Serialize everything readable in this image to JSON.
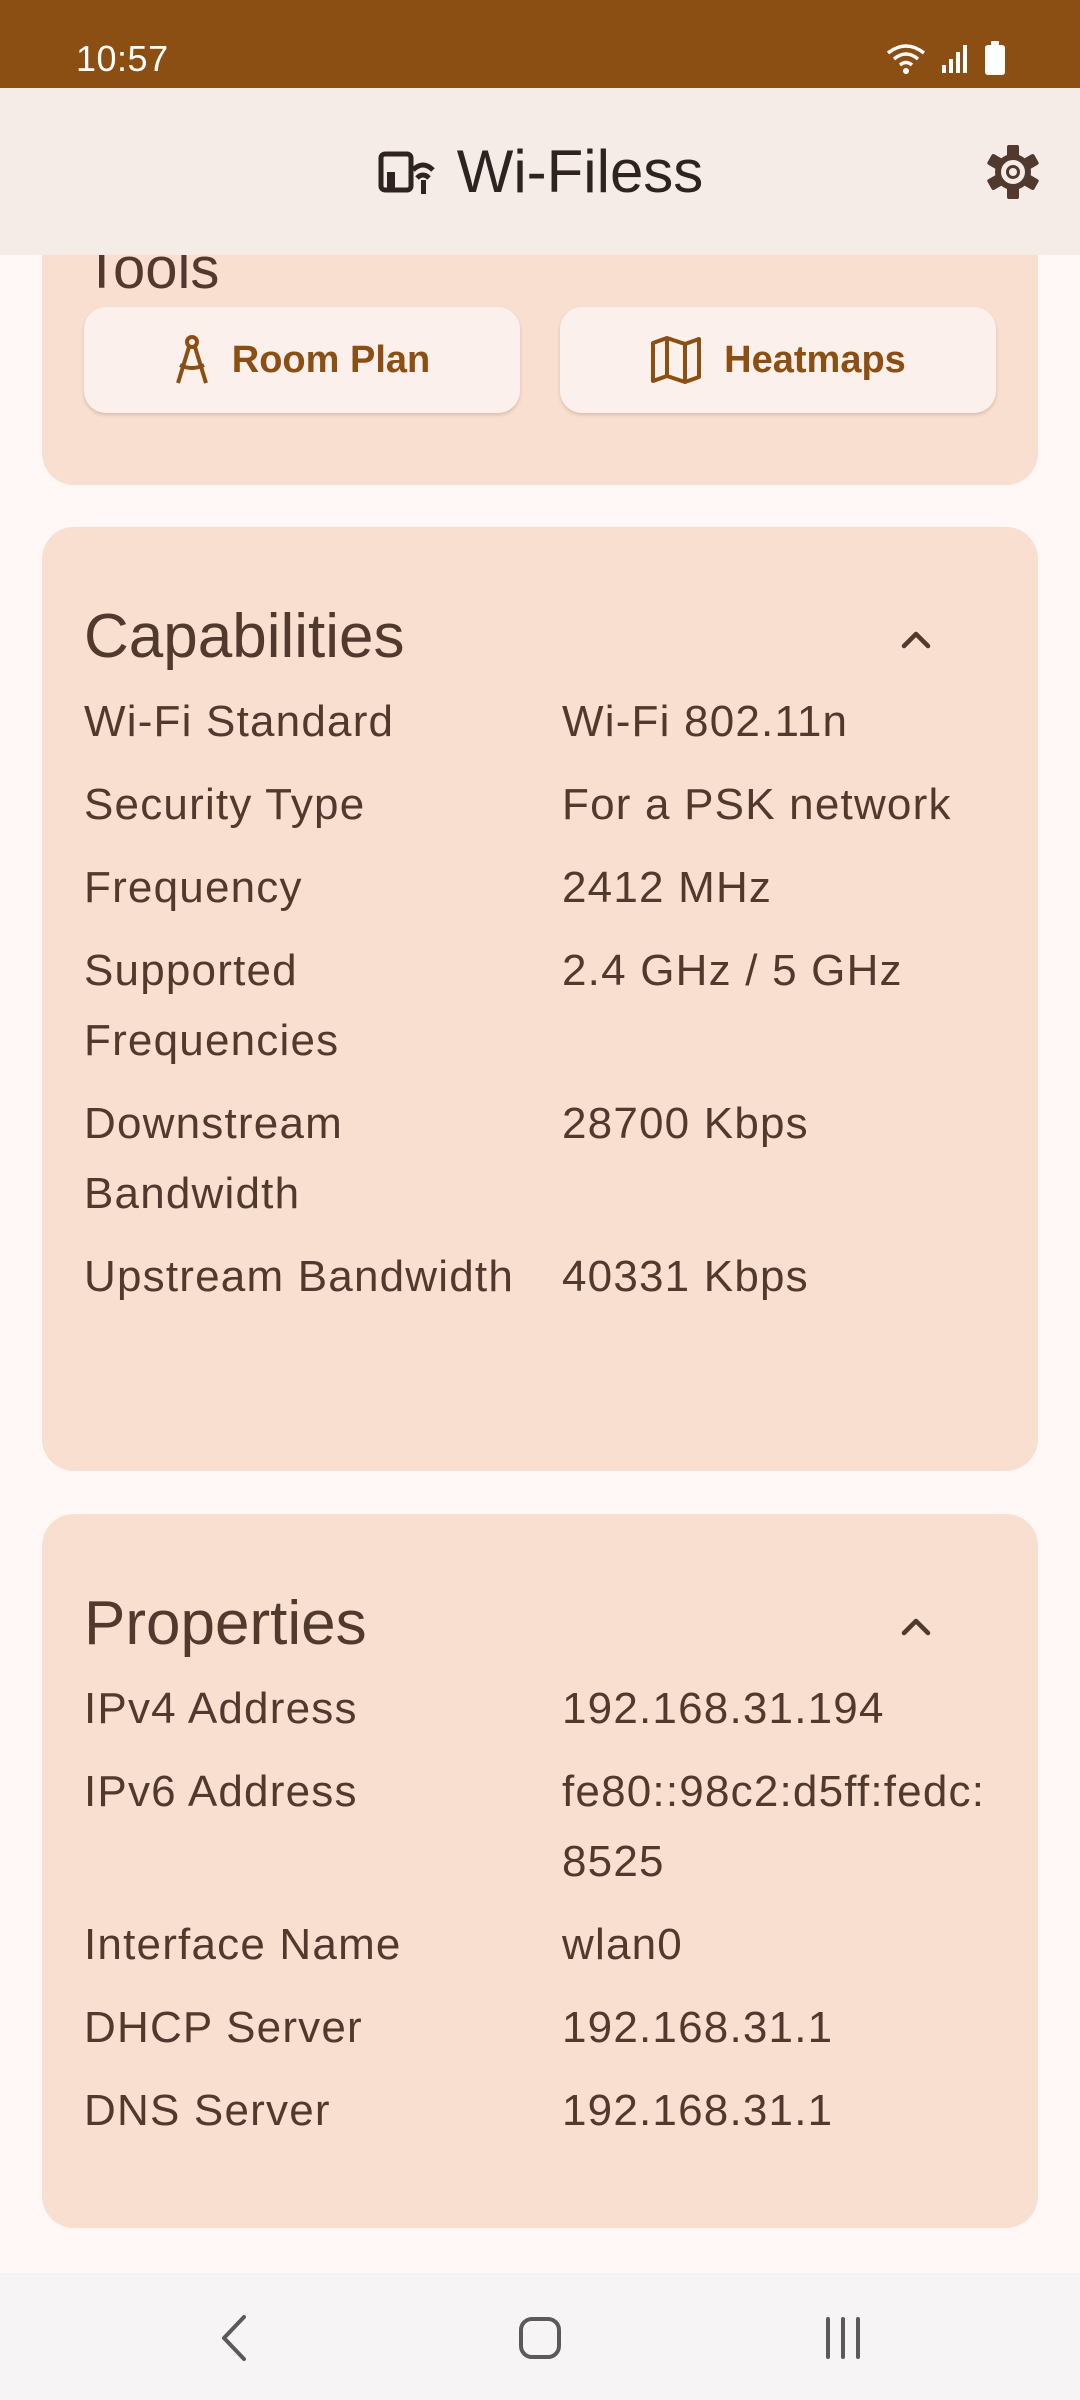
{
  "status_bar": {
    "time": "10:57"
  },
  "app_bar": {
    "title": "Wi-Filess",
    "icons": [
      "router-wifi-icon",
      "settings-gear-icon"
    ]
  },
  "tools": {
    "heading": "Tools",
    "buttons": [
      {
        "label": "Room Plan",
        "icon": "compass-drafting-icon"
      },
      {
        "label": "Heatmaps",
        "icon": "map-icon"
      }
    ]
  },
  "capabilities": {
    "heading": "Capabilities",
    "rows": [
      {
        "key": "Wi-Fi Standard",
        "value": "Wi-Fi 802.11n"
      },
      {
        "key": "Security Type",
        "value": "For a PSK network"
      },
      {
        "key": "Frequency",
        "value": "2412 MHz"
      },
      {
        "key": "Supported Frequencies",
        "value": "2.4 GHz / 5 GHz"
      },
      {
        "key": "Downstream Bandwidth",
        "value": "28700 Kbps"
      },
      {
        "key": "Upstream Bandwidth",
        "value": "40331 Kbps"
      }
    ]
  },
  "properties": {
    "heading": "Properties",
    "rows": [
      {
        "key": "IPv4 Address",
        "value": "192.168.31.194"
      },
      {
        "key": "IPv6 Address",
        "value": "fe80::98c2:d5ff:fedc:8525"
      },
      {
        "key": "Interface Name",
        "value": "wlan0"
      },
      {
        "key": "DHCP Server",
        "value": "192.168.31.1"
      },
      {
        "key": "DNS Server",
        "value": "192.168.31.1"
      }
    ]
  },
  "colors": {
    "status_bar": "#8B4F13",
    "app_bar": "#F5ECE7",
    "card": "#F8DFCF",
    "accent": "#8B4F13",
    "text": "#52392D"
  }
}
